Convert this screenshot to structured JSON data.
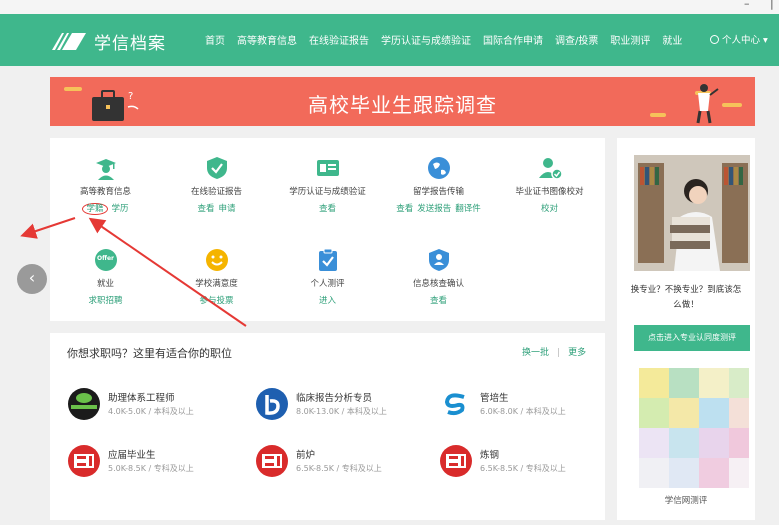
{
  "window": {
    "minimize": "–",
    "divider": "|"
  },
  "nav": {
    "logo_text": "学信档案",
    "items": [
      "首页",
      "高等教育信息",
      "在线验证报告",
      "学历认证与成绩验证",
      "国际合作申请",
      "调查/投票",
      "职业测评",
      "就业"
    ],
    "user": "个人中心 ▾",
    "bg_color": "#3fb78c"
  },
  "banner": {
    "title": "高校毕业生跟踪调查",
    "bg_color": "#f26a5a"
  },
  "services": [
    {
      "title": "高等教育信息",
      "links": [
        "学籍",
        "学历"
      ],
      "icon": "graduate-icon",
      "color": "#3fb78c"
    },
    {
      "title": "在线验证报告",
      "links": [
        "查看",
        "申请"
      ],
      "icon": "shield-check-icon",
      "color": "#3fb78c"
    },
    {
      "title": "学历认证与成绩验证",
      "links": [
        "查看"
      ],
      "icon": "id-card-icon",
      "color": "#3fb78c"
    },
    {
      "title": "留学报告传输",
      "links": [
        "查看",
        "发送报告",
        "翻译件"
      ],
      "icon": "globe-icon",
      "color": "#3a8fd8"
    },
    {
      "title": "毕业证书图像校对",
      "links": [
        "校对"
      ],
      "icon": "user-check-icon",
      "color": "#3fb78c"
    },
    {
      "title": "就业",
      "links": [
        "求职招聘"
      ],
      "icon": "offer-icon",
      "color": "#3fb78c",
      "badge": "Offer"
    },
    {
      "title": "学校满意度",
      "links": [
        "参与投票"
      ],
      "icon": "smiley-icon",
      "color": "#f5b400"
    },
    {
      "title": "个人测评",
      "links": [
        "进入"
      ],
      "icon": "clipboard-check-icon",
      "color": "#3a8fd8"
    },
    {
      "title": "信息核查确认",
      "links": [
        "查看"
      ],
      "icon": "person-badge-icon",
      "color": "#3a8fd8"
    }
  ],
  "jobs": {
    "heading": "你想求职吗？这里有适合你的职位",
    "refresh": "换一批",
    "more": "更多",
    "items": [
      {
        "title": "助理体系工程师",
        "detail": "4.0K-5.0K / 本科及以上",
        "logo_color": "#1b1b1b"
      },
      {
        "title": "临床报告分析专员",
        "detail": "8.0K-13.0K / 本科及以上",
        "logo_color": "#1e5fb0"
      },
      {
        "title": "管培生",
        "detail": "6.0K-8.0K / 本科及以上",
        "logo_color": "#1a8fd0"
      },
      {
        "title": "应届毕业生",
        "detail": "5.0K-8.5K / 专科及以上",
        "logo_color": "#d92b2b"
      },
      {
        "title": "前炉",
        "detail": "6.5K-8.5K / 专科及以上",
        "logo_color": "#d92b2b"
      },
      {
        "title": "炼钢",
        "detail": "6.5K-8.5K / 专科及以上",
        "logo_color": "#d92b2b"
      }
    ]
  },
  "sidebar": {
    "promo_text": "换专业？不换专业？到底该怎么做！",
    "cta": "点击进入专业认同度测评",
    "caption": "学信网测评"
  },
  "carousel": {
    "prev": "‹"
  }
}
